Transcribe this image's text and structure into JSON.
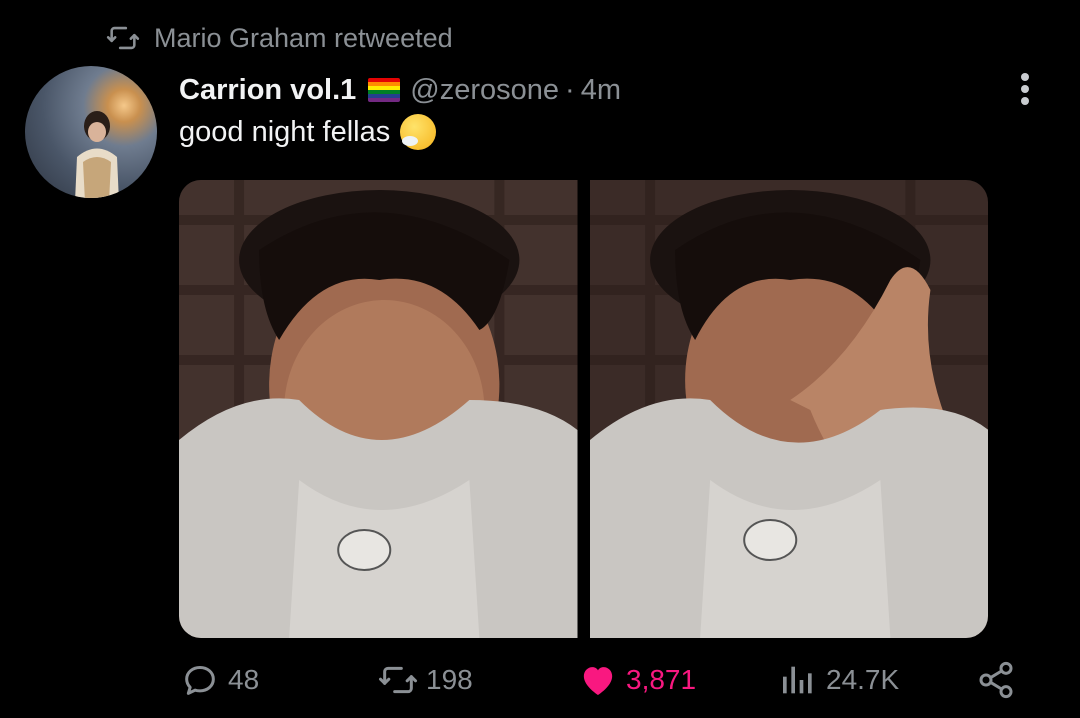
{
  "retweet": {
    "label": "Mario Graham retweeted"
  },
  "tweet": {
    "display_name": "Carrion vol.1",
    "handle": "@zerosone",
    "separator": "·",
    "time": "4m",
    "text": "good night fellas",
    "flag_icon": "rainbow-flag",
    "emoji_icon": "sneezing-face"
  },
  "actions": {
    "replies": "48",
    "retweets": "198",
    "likes": "3,871",
    "views": "24.7K"
  },
  "colors": {
    "background": "#000000",
    "secondary_text": "#8b9095",
    "like": "#f91880"
  }
}
